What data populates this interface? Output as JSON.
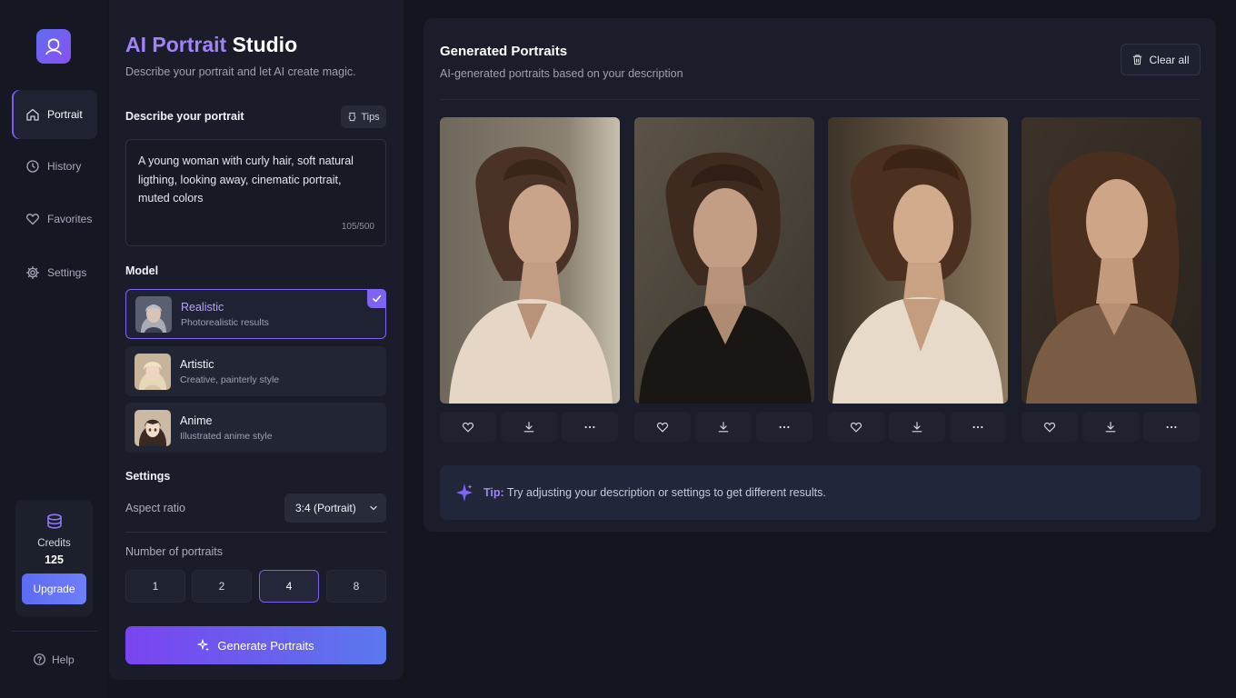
{
  "app": {
    "title_accent": "AI Portrait",
    "title_rest": " Studio",
    "subtitle": "Describe your portrait and let AI create magic."
  },
  "nav": {
    "items": [
      {
        "label": "Portrait",
        "icon": "home-icon",
        "active": true
      },
      {
        "label": "History",
        "icon": "clock-icon",
        "active": false
      },
      {
        "label": "Favorites",
        "icon": "heart-icon",
        "active": false
      },
      {
        "label": "Settings",
        "icon": "gear-icon",
        "active": false
      }
    ],
    "help_label": "Help"
  },
  "credits": {
    "label": "Credits",
    "value": "125",
    "upgrade_label": "Upgrade"
  },
  "describe": {
    "title": "Describe your portrait",
    "tips_label": "Tips",
    "prompt": "A young woman with curly hair, soft natural ligthing, looking away, cinematic portrait, muted colors",
    "counter": "105/500"
  },
  "model": {
    "title": "Model",
    "options": [
      {
        "name": "Realistic",
        "desc": "Photorealistic results",
        "selected": true
      },
      {
        "name": "Artistic",
        "desc": "Creative, painterly style",
        "selected": false
      },
      {
        "name": "Anime",
        "desc": "Illustrated anime style",
        "selected": false
      }
    ]
  },
  "settings": {
    "title": "Settings",
    "aspect_label": "Aspect ratio",
    "aspect_value": "3:4 (Portrait)",
    "count_label": "Number of portraits",
    "count_options": [
      "1",
      "2",
      "4",
      "8"
    ],
    "count_selected": "4"
  },
  "generate_label": "Generate Portraits",
  "results": {
    "title": "Generated Portraits",
    "subtitle": "AI-generated portraits based on your description",
    "clear_label": "Clear all",
    "portraits": [
      {
        "shirt": "cream",
        "bg": "warm-gray"
      },
      {
        "shirt": "black",
        "bg": "dark"
      },
      {
        "shirt": "cream",
        "bg": "warm"
      },
      {
        "shirt": "brown",
        "bg": "dark-warm"
      }
    ],
    "tip_label": "Tip:",
    "tip_text": " Try adjusting your description or settings to get different results."
  },
  "colors": {
    "accent": "#7f63f3",
    "accent_light": "#a283f5",
    "background": "#13151f",
    "panel": "#1a1d29"
  }
}
